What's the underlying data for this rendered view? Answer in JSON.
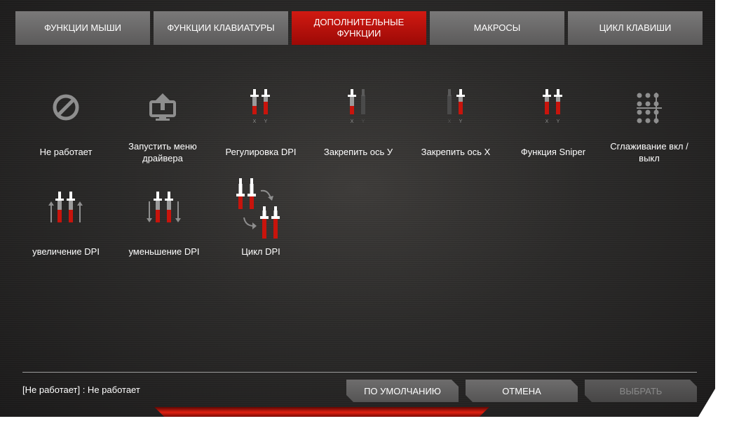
{
  "tabs": [
    {
      "label": "ФУНКЦИИ МЫШИ"
    },
    {
      "label": "ФУНКЦИИ КЛАВИАТУРЫ"
    },
    {
      "label": "ДОПОЛНИТЕЛЬНЫЕ ФУНКЦИИ"
    },
    {
      "label": "МАКРОСЫ"
    },
    {
      "label": "ЦИКЛ КЛАВИШИ"
    }
  ],
  "active_tab": "ДОПОЛНИТЕЛЬНЫЕ ФУНКЦИИ",
  "functions": [
    {
      "label": "Не работает",
      "icon": "disabled-icon"
    },
    {
      "label": "Запустить меню драйвера",
      "icon": "driver-menu-icon"
    },
    {
      "label": "Регулировка DPI",
      "icon": "dpi-adjust-icon"
    },
    {
      "label": "Закрепить ось У",
      "icon": "lock-y-axis-icon"
    },
    {
      "label": "Закрепить ось X",
      "icon": "lock-x-axis-icon"
    },
    {
      "label": "Функция Sniper",
      "icon": "sniper-icon"
    },
    {
      "label": "Сглаживание вкл / выкл",
      "icon": "smoothing-icon"
    },
    {
      "label": "увеличение DPI",
      "icon": "dpi-up-icon"
    },
    {
      "label": "уменьшение DPI",
      "icon": "dpi-down-icon"
    },
    {
      "label": "Цикл DPI",
      "icon": "dpi-cycle-icon"
    }
  ],
  "axis_labels": {
    "x": "X",
    "y": "Y"
  },
  "status_text": "[Не работает] : Не работает",
  "buttons": {
    "default_label": "ПО УМОЛЧАНИЮ",
    "cancel_label": "ОТМЕНА",
    "select_label": "ВЫБРАТЬ"
  },
  "colors": {
    "accent": "#c8140c",
    "tab": "#6b6a6a",
    "background": "#2a2928"
  }
}
